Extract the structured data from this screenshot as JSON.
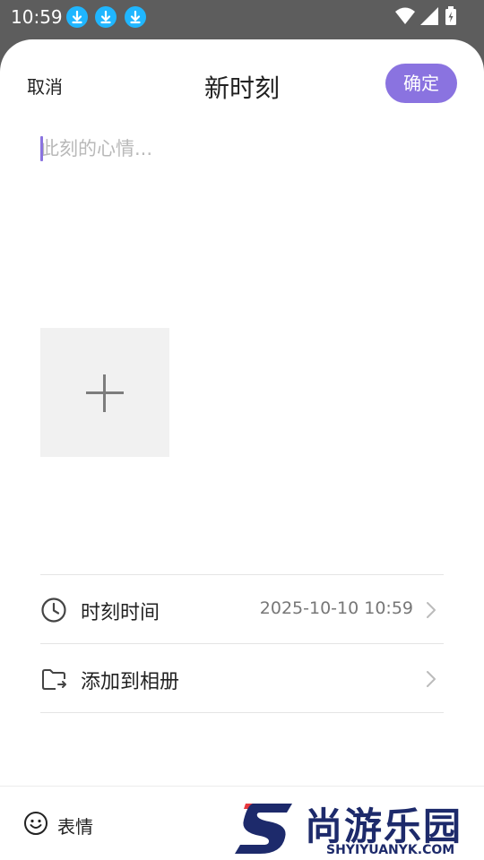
{
  "status_bar": {
    "time": "10:59",
    "download_icons": [
      "download-icon",
      "download-icon",
      "download-icon"
    ],
    "icons": [
      "wifi-icon",
      "signal-icon",
      "battery-icon"
    ]
  },
  "header": {
    "cancel_label": "取消",
    "title": "新时刻",
    "confirm_label": "确定"
  },
  "editor": {
    "placeholder": "此刻的心情...",
    "value": ""
  },
  "photo": {
    "add_icon": "plus-icon"
  },
  "rows": {
    "time": {
      "icon": "clock-icon",
      "label": "时刻时间",
      "value": "2025-10-10 10:59"
    },
    "album": {
      "icon": "folder-icon",
      "label": "添加到相册"
    }
  },
  "bottom": {
    "emoji_label": "表情",
    "emoji_icon": "smiley-icon"
  },
  "watermark": {
    "text": "尚游乐园",
    "subtext": "SHYIYUANYK.COM"
  },
  "colors": {
    "accent": "#8a73e0",
    "status_bar": "#5d5d5d",
    "download_badge": "#1fb6ff",
    "watermark": "#1d2a6b",
    "watermark_red": "#e8383d"
  }
}
